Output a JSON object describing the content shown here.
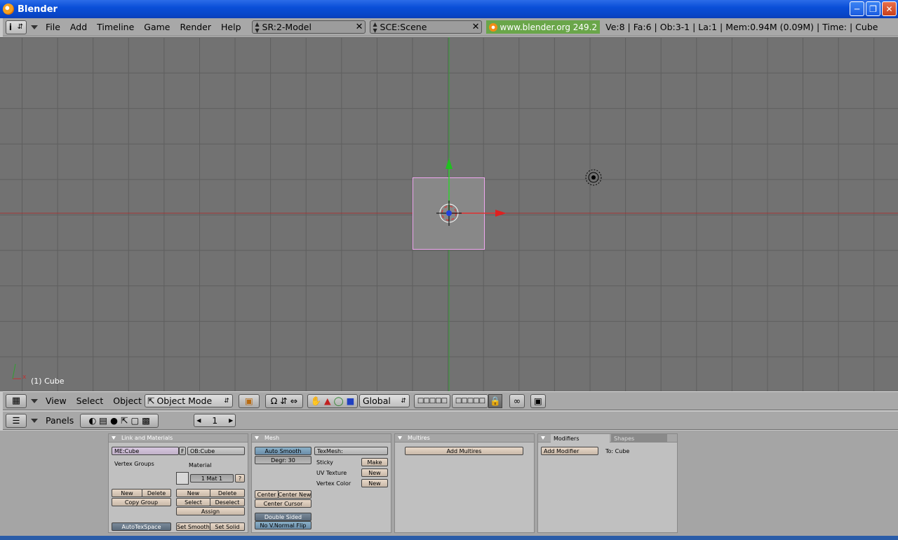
{
  "window": {
    "title": "Blender"
  },
  "info_header": {
    "menus": [
      "File",
      "Add",
      "Timeline",
      "Game",
      "Render",
      "Help"
    ],
    "screen": "SR:2-Model",
    "scene": "SCE:Scene",
    "url": "www.blender.org 249.2",
    "stats": "Ve:8 | Fa:6 | Ob:3-1 | La:1  | Mem:0.94M (0.09M)  | Time: | Cube"
  },
  "viewport": {
    "object_label": "(1) Cube",
    "axis_x_label": "x",
    "colors": {
      "background": "#727272",
      "grid": "#5e5e5e",
      "x_axis": "#b03030",
      "y_axis": "#30a030",
      "selected": "#f0a0f0"
    }
  },
  "view3d_header": {
    "menus": [
      "View",
      "Select",
      "Object"
    ],
    "mode": "Object Mode",
    "orientation": "Global"
  },
  "buttons_header": {
    "label": "Panels",
    "frame": "1"
  },
  "panels": {
    "link_materials": {
      "title": "Link and Materials",
      "mesh_name": "ME:Cube",
      "f_label": "F",
      "object_name": "OB:Cube",
      "vertex_groups": "Vertex Groups",
      "material": "Material",
      "mat_index": "1 Mat 1",
      "question": "?",
      "new": "New",
      "delete": "Delete",
      "copy_group": "Copy Group",
      "mat_new": "New",
      "mat_delete": "Delete",
      "select": "Select",
      "deselect": "Deselect",
      "assign": "Assign",
      "autotexspace": "AutoTexSpace",
      "set_smooth": "Set Smooth",
      "set_solid": "Set Solid"
    },
    "mesh": {
      "title": "Mesh",
      "auto_smooth": "Auto Smooth",
      "degr": "Degr: 30",
      "texmesh": "TexMesh:",
      "sticky": "Sticky",
      "make": "Make",
      "uv_texture": "UV Texture",
      "uv_new": "New",
      "vertex_color": "Vertex Color",
      "vc_new": "New",
      "center": "Center",
      "center_new": "Center New",
      "center_cursor": "Center Cursor",
      "double_sided": "Double Sided",
      "no_vnormal_flip": "No V.Normal Flip"
    },
    "multires": {
      "title": "Multires",
      "add_multires": "Add Multires"
    },
    "modifiers": {
      "tab_modifiers": "Modifiers",
      "tab_shapes": "Shapes",
      "add_modifier": "Add Modifier",
      "to_label": "To: Cube"
    }
  }
}
